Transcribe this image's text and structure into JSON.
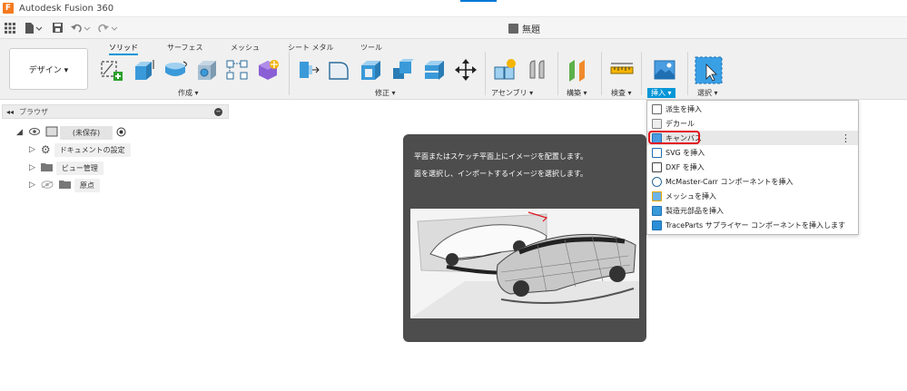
{
  "titlebar": {
    "app_name": "Autodesk Fusion 360"
  },
  "document": {
    "title": "無題"
  },
  "workspace": {
    "label": "デザイン ▾"
  },
  "tabs": [
    "ソリッド",
    "サーフェス",
    "メッシュ",
    "シート メタル",
    "ツール"
  ],
  "groups": {
    "create": "作成 ▾",
    "modify": "修正 ▾",
    "assemble": "アセンブリ ▾",
    "construct": "構築 ▾",
    "inspect": "検査 ▾",
    "insert": "挿入 ▾",
    "select": "選択 ▾"
  },
  "browser": {
    "title": "ブラウザ",
    "root": "(未保存)",
    "items": [
      "ドキュメントの設定",
      "ビュー管理",
      "原点"
    ]
  },
  "tooltip": {
    "line1": "平面またはスケッチ平面上にイメージを配置します。",
    "line2": "面を選択し、インポートするイメージを選択します。"
  },
  "insert_menu": {
    "items": [
      "派生を挿入",
      "デカール",
      "キャンバス",
      "SVG を挿入",
      "DXF を挿入",
      "McMaster-Carr コンポーネントを挿入",
      "メッシュを挿入",
      "製造元部品を挿入",
      "TraceParts サプライヤー コンポーネントを挿入します"
    ],
    "more_glyph": "⋮"
  },
  "colors": {
    "accent": "#0696d7",
    "highlight_ring": "#e0121b",
    "tooltip_bg": "#4d4d4d"
  }
}
